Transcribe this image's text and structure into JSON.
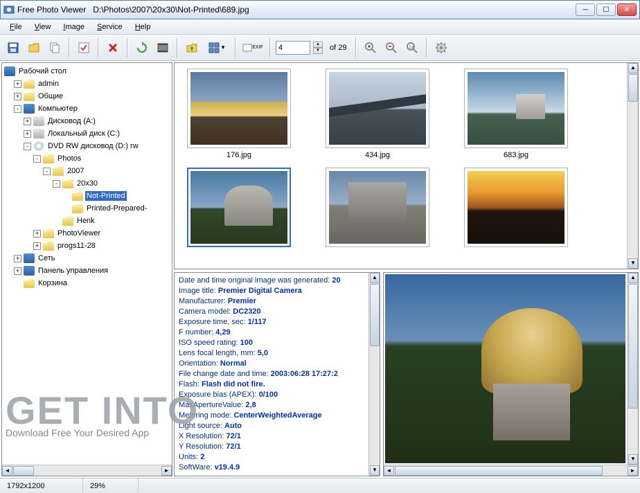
{
  "window": {
    "app_name": "Free Photo Viewer",
    "path": "D:\\Photos\\2007\\20x30\\Not-Printed\\689.jpg"
  },
  "menu": [
    "File",
    "View",
    "Image",
    "Service",
    "Help"
  ],
  "toolbar": {
    "page_value": "4",
    "page_total": "of  29"
  },
  "tree": {
    "root": "Рабочий стол",
    "items": [
      {
        "expand": "+",
        "icon": "folder",
        "label": "admin",
        "indent": 1
      },
      {
        "expand": "+",
        "icon": "folder",
        "label": "Общие",
        "indent": 1
      },
      {
        "expand": "-",
        "icon": "desktop",
        "label": "Компьютер",
        "indent": 1
      },
      {
        "expand": "+",
        "icon": "disk",
        "label": "Дисковод (A:)",
        "indent": 2
      },
      {
        "expand": "+",
        "icon": "disk",
        "label": "Локальный диск (C:)",
        "indent": 2
      },
      {
        "expand": "-",
        "icon": "cd",
        "label": "DVD RW дисковод (D:) rw",
        "indent": 2
      },
      {
        "expand": "-",
        "icon": "folder",
        "label": "Photos",
        "indent": 3
      },
      {
        "expand": "-",
        "icon": "folder",
        "label": "2007",
        "indent": 4
      },
      {
        "expand": "-",
        "icon": "folder",
        "label": "20x30",
        "indent": 5
      },
      {
        "expand": "",
        "icon": "folder",
        "label": "Not-Printed",
        "indent": 6,
        "selected": true
      },
      {
        "expand": "",
        "icon": "folder",
        "label": "Printed-Prepared-",
        "indent": 6
      },
      {
        "expand": "",
        "icon": "folder",
        "label": "Henk",
        "indent": 5
      },
      {
        "expand": "+",
        "icon": "folder",
        "label": "PhotoViewer",
        "indent": 3
      },
      {
        "expand": "+",
        "icon": "folder",
        "label": "progs11-28",
        "indent": 3
      },
      {
        "expand": "+",
        "icon": "desktop",
        "label": "Сеть",
        "indent": 1
      },
      {
        "expand": "+",
        "icon": "desktop",
        "label": "Панель управления",
        "indent": 1
      },
      {
        "expand": "",
        "icon": "folder",
        "label": "Корзина",
        "indent": 1
      }
    ]
  },
  "thumbnails": [
    {
      "name": "176.jpg"
    },
    {
      "name": "434.jpg"
    },
    {
      "name": "683.jpg"
    }
  ],
  "exif": [
    {
      "k": "Date and time original image was generated:",
      "v": "20"
    },
    {
      "k": "Image title:",
      "v": "Premier Digital Camera"
    },
    {
      "k": "Manufacturer:",
      "v": "Premier"
    },
    {
      "k": "Camera model:",
      "v": "DC2320"
    },
    {
      "k": "Exposure time, sec:",
      "v": "1/117"
    },
    {
      "k": "F number:",
      "v": "4,29"
    },
    {
      "k": "ISO speed rating:",
      "v": "100"
    },
    {
      "k": "Lens focal length, mm:",
      "v": "5,0"
    },
    {
      "k": "Orientation:",
      "v": "Normal"
    },
    {
      "k": "File change date and time:",
      "v": "2003:06:28 17:27:2"
    },
    {
      "k": "Flash:",
      "v": "Flash did not fire."
    },
    {
      "k": "Exposure bias (APEX):",
      "v": "0/100"
    },
    {
      "k": "MaxApertureValue:",
      "v": "2,8"
    },
    {
      "k": "Metering mode:",
      "v": "CenterWeightedAverage"
    },
    {
      "k": "Light source:",
      "v": "Auto"
    },
    {
      "k": "X Resolution:",
      "v": "72/1"
    },
    {
      "k": "Y Resolution:",
      "v": "72/1"
    },
    {
      "k": "Units:",
      "v": "2"
    },
    {
      "k": "SoftWare:",
      "v": "v19.4.9"
    }
  ],
  "status": {
    "res": "1792x1200",
    "zoom": "29%"
  },
  "watermark": {
    "big": "GET INTO",
    "sub": "Download Free Your Desired App"
  }
}
